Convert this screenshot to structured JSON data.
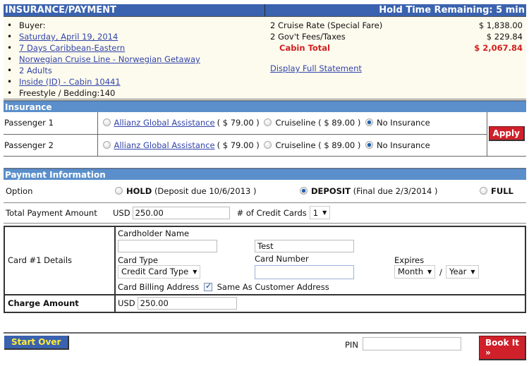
{
  "header": {
    "title": "INSURANCE/PAYMENT",
    "hold_time": "Hold Time Remaining: 5 min"
  },
  "summary": {
    "buyer_label": "Buyer:",
    "items": [
      {
        "text": "Saturday, April 19, 2014",
        "link": true
      },
      {
        "text": "7 Days Caribbean-Eastern",
        "link": true
      },
      {
        "text": "Norwegian Cruise Line - Norwegian Getaway",
        "link": true
      },
      {
        "text": "2 Adults",
        "link": false
      },
      {
        "text": "Inside (ID) - Cabin 10441",
        "link": true
      },
      {
        "text": "Freestyle / Bedding:140",
        "link": false
      }
    ],
    "fees": [
      {
        "label": "2 Cruise Rate (Special Fare)",
        "amount": "$ 1,838.00"
      },
      {
        "label": "2 Gov't Fees/Taxes",
        "amount": "$ 229.84"
      }
    ],
    "total": {
      "label": "Cabin Total",
      "amount": "$ 2,067.84"
    },
    "full_statement_link": "Display Full Statement"
  },
  "insurance": {
    "section_title": "Insurance",
    "passengers": [
      {
        "label": "Passenger 1",
        "options": [
          {
            "name": "Allianz Global Assistance",
            "price": "( $ 79.00 )",
            "link": true,
            "selected": false
          },
          {
            "name": "Cruiseline",
            "price": "( $ 89.00 )",
            "link": false,
            "selected": false
          },
          {
            "name": "No Insurance",
            "price": "",
            "link": false,
            "selected": true
          }
        ]
      },
      {
        "label": "Passenger 2",
        "options": [
          {
            "name": "Allianz Global Assistance",
            "price": "( $ 79.00 )",
            "link": true,
            "selected": false
          },
          {
            "name": "Cruiseline",
            "price": "( $ 89.00 )",
            "link": false,
            "selected": false
          },
          {
            "name": "No Insurance",
            "price": "",
            "link": false,
            "selected": true
          }
        ]
      }
    ],
    "apply_label": "Apply"
  },
  "payment": {
    "section_title": "Payment Information",
    "option_label": "Option",
    "options": [
      {
        "name": "HOLD",
        "detail": "(Deposit due 10/6/2013 )",
        "selected": false
      },
      {
        "name": "DEPOSIT",
        "detail": "(Final due 2/3/2014 )",
        "selected": true
      },
      {
        "name": "FULL",
        "detail": "",
        "selected": false
      }
    ],
    "total_label": "Total Payment Amount",
    "currency": "USD",
    "total_value": "250.00",
    "num_cards_label": "# of Credit Cards",
    "num_cards_value": "1",
    "card": {
      "label": "Card #1 Details",
      "cardholder_label": "Cardholder Name",
      "cardholder_first": "",
      "cardholder_last": "Test",
      "card_type_label": "Card Type",
      "card_type_value": "Credit Card Type",
      "card_number_label": "Card Number",
      "card_number_value": "",
      "expires_label": "Expires",
      "month_value": "Month",
      "year_value": "Year",
      "separator": "/",
      "billing_label": "Card Billing Address",
      "same_address_label": "Same As Customer Address",
      "same_address_checked": true
    },
    "charge_label": "Charge Amount",
    "charge_currency": "USD",
    "charge_value": "250.00"
  },
  "footer": {
    "start_over_label": "Start Over",
    "pin_label": "PIN",
    "pin_value": "",
    "book_label": "Book It »"
  },
  "colors": {
    "header_blue": "#3a62ae",
    "section_blue": "#5b8fcb",
    "accent_red": "#d0202a",
    "summary_bg": "#fdfbee",
    "start_over_text": "#ffec3a"
  }
}
